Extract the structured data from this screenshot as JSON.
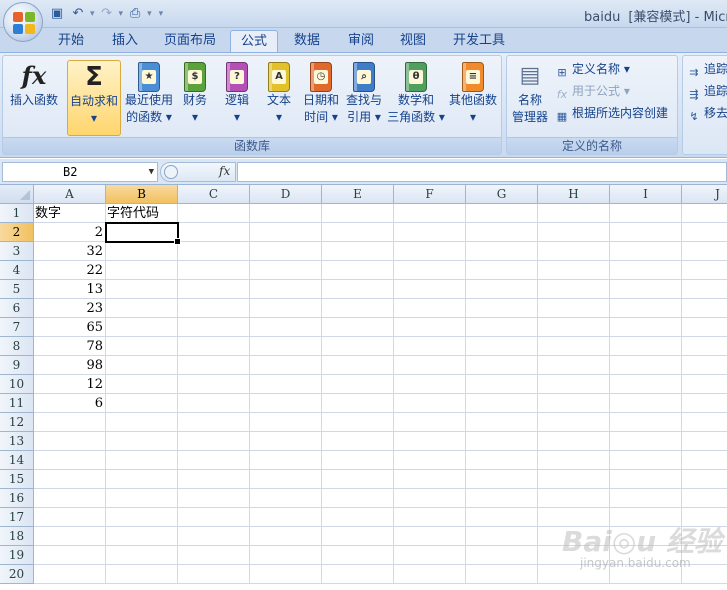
{
  "window": {
    "app_title": "baidu",
    "mode": "[兼容模式]",
    "app_suffix": "- Micro"
  },
  "tabs": [
    {
      "label": "开始"
    },
    {
      "label": "插入"
    },
    {
      "label": "页面布局"
    },
    {
      "label": "公式",
      "active": true
    },
    {
      "label": "数据"
    },
    {
      "label": "审阅"
    },
    {
      "label": "视图"
    },
    {
      "label": "开发工具"
    }
  ],
  "ribbon": {
    "function_library": {
      "label": "函数库",
      "insert_function": "插入函数",
      "autosum": {
        "line1": "自动求和",
        "line2": "▾"
      },
      "recent": {
        "line1": "最近使用",
        "line2": "的函数 ▾"
      },
      "financial": {
        "line1": "财务",
        "line2": "▾"
      },
      "logical": {
        "line1": "逻辑",
        "line2": "▾"
      },
      "text": {
        "line1": "文本",
        "line2": "▾"
      },
      "datetime": {
        "line1": "日期和",
        "line2": "时间 ▾"
      },
      "lookup": {
        "line1": "查找与",
        "line2": "引用 ▾"
      },
      "math": {
        "line1": "数学和",
        "line2": "三角函数 ▾"
      },
      "more": {
        "line1": "其他函数",
        "line2": "▾"
      }
    },
    "defined_names": {
      "label": "定义的名称",
      "name_manager": {
        "line1": "名称",
        "line2": "管理器"
      },
      "define_name": "定义名称 ▾",
      "use_in_formula": "用于公式 ▾",
      "create_from_selection": "根据所选内容创建"
    },
    "auditing": {
      "trace_precedents": "追踪",
      "trace_dependents": "追踪",
      "remove_arrows": "移去"
    }
  },
  "formula_bar": {
    "name_box": "B2",
    "formula": ""
  },
  "sheet": {
    "columns": [
      "A",
      "B",
      "C",
      "D",
      "E",
      "F",
      "G",
      "H",
      "I",
      "J"
    ],
    "rows": [
      "1",
      "2",
      "3",
      "4",
      "5",
      "6",
      "7",
      "8",
      "9",
      "10",
      "11",
      "12",
      "13",
      "14",
      "15",
      "16",
      "17",
      "18",
      "19",
      "20"
    ],
    "selected_col": "B",
    "selected_row": "2",
    "cells": {
      "A1": "数字",
      "B1": "字符代码",
      "A2": "2",
      "A3": "32",
      "A4": "22",
      "A5": "13",
      "A6": "23",
      "A7": "65",
      "A8": "78",
      "A9": "98",
      "A10": "12",
      "A11": "6"
    }
  },
  "watermark": {
    "brand": "Bai◎u 经验",
    "url": "jingyan.baidu.com"
  }
}
